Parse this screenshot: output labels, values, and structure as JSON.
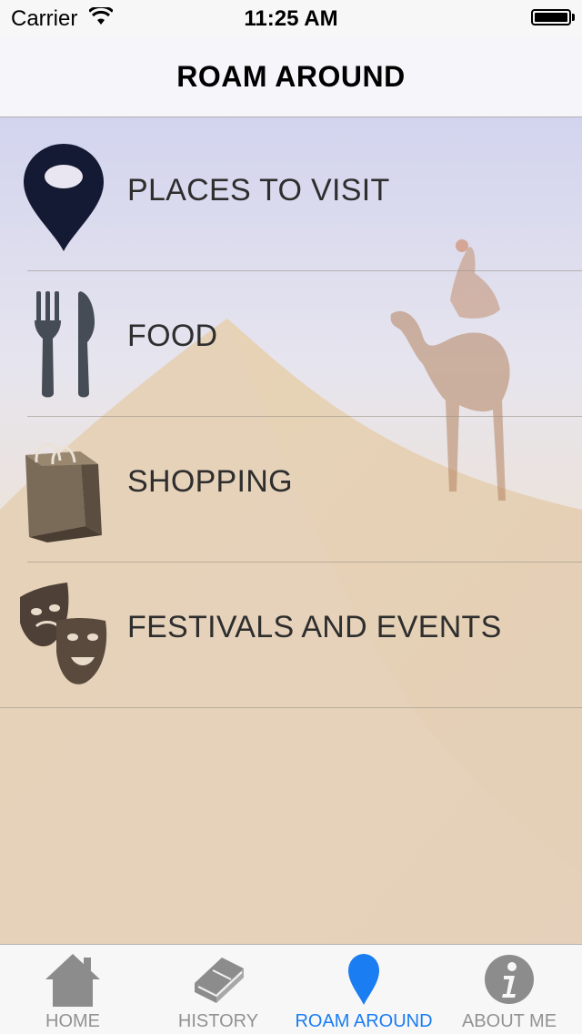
{
  "status_bar": {
    "carrier": "Carrier",
    "time": "11:25 AM",
    "wifi_icon": "wifi-icon",
    "battery_icon": "battery-icon"
  },
  "nav_bar": {
    "title": "ROAM AROUND"
  },
  "menu": {
    "items": [
      {
        "label": "PLACES TO VISIT",
        "icon": "map-pin-icon"
      },
      {
        "label": "FOOD",
        "icon": "fork-knife-icon"
      },
      {
        "label": "SHOPPING",
        "icon": "shopping-bag-icon"
      },
      {
        "label": "FESTIVALS AND EVENTS",
        "icon": "theater-masks-icon"
      }
    ]
  },
  "tab_bar": {
    "tabs": [
      {
        "label": "HOME",
        "icon": "house-icon"
      },
      {
        "label": "HISTORY",
        "icon": "book-icon"
      },
      {
        "label": "ROAM AROUND",
        "icon": "map-pin-icon"
      },
      {
        "label": "ABOUT ME",
        "icon": "info-icon"
      }
    ],
    "active_tab": "ROAM AROUND",
    "active_color": "#1a7df2",
    "inactive_color": "#929292"
  }
}
